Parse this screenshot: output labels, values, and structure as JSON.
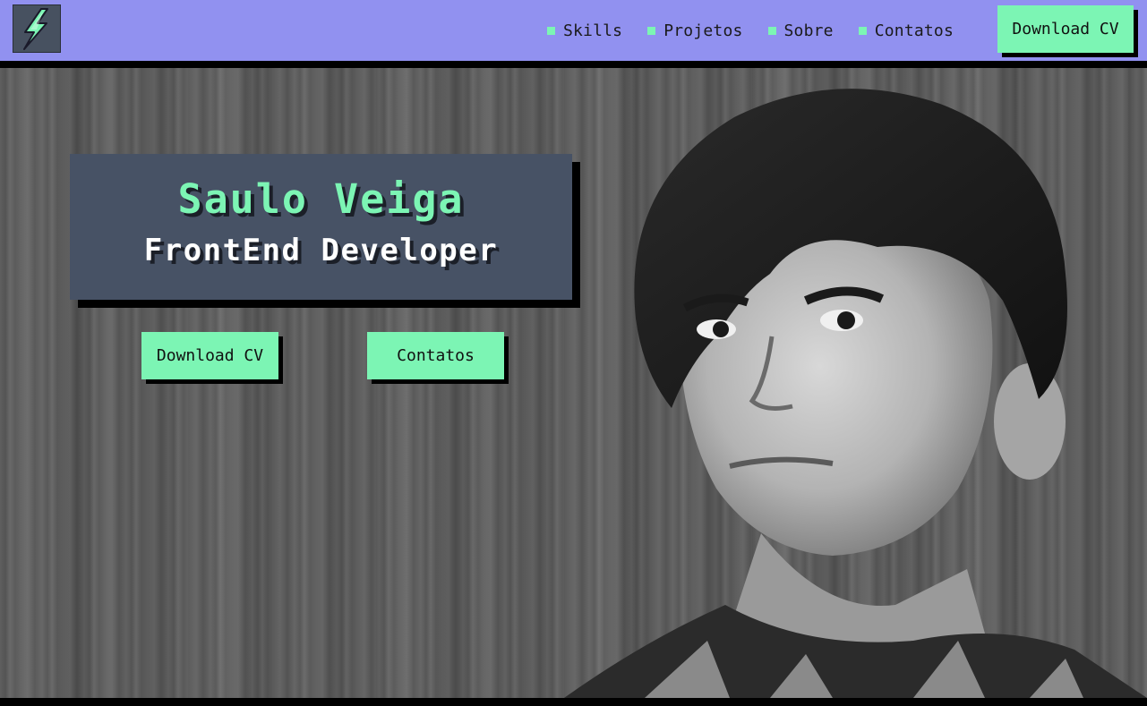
{
  "header": {
    "logo_icon": "lightning-bolt-icon",
    "nav": [
      {
        "label": "Skills"
      },
      {
        "label": "Projetos"
      },
      {
        "label": "Sobre"
      },
      {
        "label": "Contatos"
      }
    ],
    "cta_label": "Download CV"
  },
  "hero": {
    "name": "Saulo Veiga",
    "role": "FrontEnd Developer",
    "primary_button": "Download CV",
    "secondary_button": "Contatos"
  },
  "colors": {
    "header_bg": "#9191f0",
    "accent": "#7cf5b4",
    "card_bg": "#475265"
  }
}
